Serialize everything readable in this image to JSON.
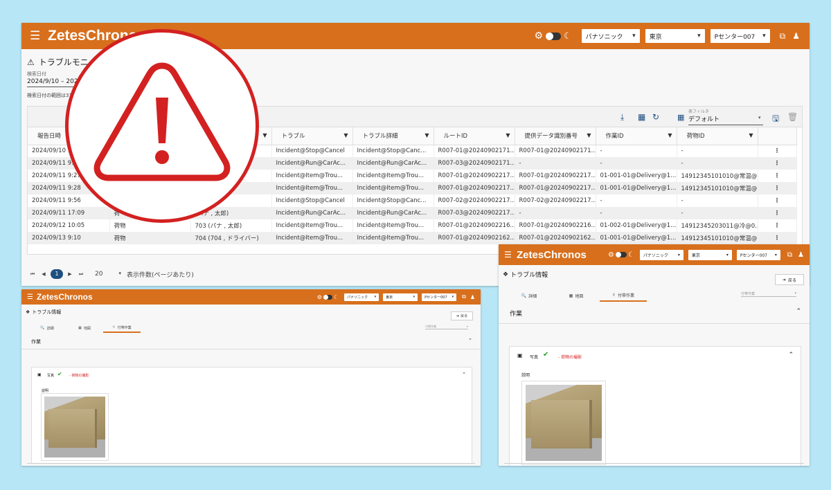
{
  "app": {
    "brand": "ZetesChronos"
  },
  "topbar": {
    "company": "パナソニック",
    "region": "東京",
    "center": "Pセンター007"
  },
  "list_page": {
    "title": "トラブルモニ",
    "date_label": "検索日付",
    "date_value": "2024/9/10 – 202",
    "date_note": "検索日付の範囲は31日",
    "filter_label": "表フィルタ",
    "filter_value": "デフォルト",
    "columns": [
      "報告日時",
      "",
      "",
      "トラブル",
      "トラブル詳細",
      "ルートID",
      "提供データ識別番号",
      "作業ID",
      "荷物ID"
    ],
    "rows": [
      [
        "2024/09/10 1",
        "",
        "",
        "Incident@Stop@Cancel",
        "Incident@Stop@Canc...",
        "R007-01@20240902171...",
        "R007-01@20240902171...",
        "-",
        "-"
      ],
      [
        "2024/09/11 9:1",
        "",
        "",
        "Incident@Run@CarAc...",
        "Incident@Run@CarAc...",
        "R007-03@20240902171...",
        "-",
        "-",
        "-"
      ],
      [
        "2024/09/11 9:27",
        "",
        "",
        "Incident@Item@Trou...",
        "Incident@Item@Trou...",
        "R007-01@20240902217...",
        "R007-01@20240902217...",
        "01-001-01@Delivery@1...",
        "14912345101010@常温@..."
      ],
      [
        "2024/09/11 9:28",
        "",
        "",
        "Incident@Item@Trou...",
        "Incident@Item@Trou...",
        "R007-01@20240902217...",
        "R007-01@20240902217...",
        "01-001-01@Delivery@1...",
        "14912345101010@常温@..."
      ],
      [
        "2024/09/11 9:56",
        "",
        "太郎)",
        "Incident@Stop@Cancel",
        "Incident@Stop@Canc...",
        "R007-02@20240902217...",
        "R007-02@20240902217...",
        "-",
        "-"
      ],
      [
        "2024/09/11 17:09",
        "荷",
        "(パナ , 太郎)",
        "Incident@Run@CarAc...",
        "Incident@Run@CarAc...",
        "R007-03@20240902217...",
        "-",
        "-",
        "-"
      ],
      [
        "2024/09/12 10:05",
        "荷物",
        "703 (パナ , 太郎)",
        "Incident@Item@Trou...",
        "Incident@Item@Trou...",
        "R007-01@20240902216...",
        "R007-01@20240902216...",
        "01-002-01@Delivery@1...",
        "14912345203011@冷@0..."
      ],
      [
        "2024/09/13 9:10",
        "荷物",
        "704 (704 , ドライバー)",
        "Incident@Item@Trou...",
        "Incident@Item@Trou...",
        "R007-01@20240902162...",
        "R007-01@20240902162...",
        "01-001-01@Delivery@1...",
        "14912345101010@常温@..."
      ]
    ],
    "pager": {
      "current": "1",
      "page_size": "20",
      "page_size_label": "表示件数(ページあたり)"
    }
  },
  "detail_page": {
    "title": "トラブル情報",
    "back_label": "戻る",
    "tabs": [
      "詳細",
      "地図",
      "付帯作業"
    ],
    "tab_select_placeholder": "付帯作業",
    "section": "作業",
    "photo_label": "写真",
    "photo_task": "- 荷物の撮影",
    "desc_label": "説明"
  },
  "colors": {
    "brand": "#d86f1c",
    "primary": "#1f4f7f",
    "alert": "#d32121"
  }
}
